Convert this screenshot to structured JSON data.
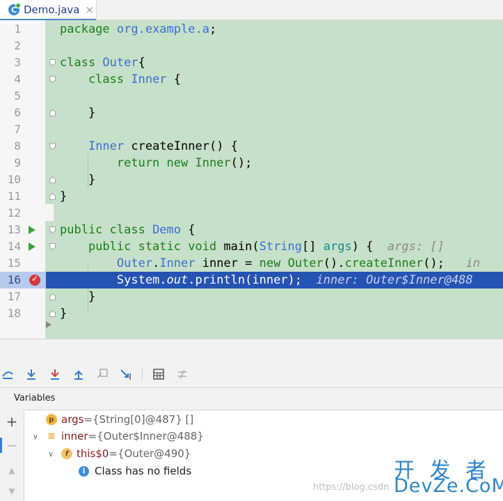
{
  "tab": {
    "icon_letter": "C",
    "file_name": "Demo.java",
    "close": "×"
  },
  "editor": {
    "lines": [
      {
        "n": "1",
        "segs": [
          {
            "t": "package ",
            "c": "kw"
          },
          {
            "t": "org.example.a",
            "c": "ty"
          },
          {
            "t": ";",
            "c": ""
          }
        ]
      },
      {
        "n": "2",
        "segs": []
      },
      {
        "n": "3",
        "segs": [
          {
            "t": "class ",
            "c": "kw"
          },
          {
            "t": "Outer",
            "c": "ty"
          },
          {
            "t": "{",
            "c": ""
          }
        ]
      },
      {
        "n": "4",
        "segs": [
          {
            "t": "    class ",
            "c": "kw"
          },
          {
            "t": "Inner",
            "c": "ty"
          },
          {
            "t": " {",
            "c": ""
          }
        ]
      },
      {
        "n": "5",
        "segs": []
      },
      {
        "n": "6",
        "segs": [
          {
            "t": "    }",
            "c": ""
          }
        ]
      },
      {
        "n": "7",
        "segs": []
      },
      {
        "n": "8",
        "segs": [
          {
            "t": "    ",
            "c": ""
          },
          {
            "t": "Inner",
            "c": "ty"
          },
          {
            "t": " createInner() {",
            "c": ""
          }
        ]
      },
      {
        "n": "9",
        "segs": [
          {
            "t": "        return new ",
            "c": "kw"
          },
          {
            "t": "Inner",
            "c": "kw"
          },
          {
            "t": "();",
            "c": ""
          }
        ]
      },
      {
        "n": "10",
        "segs": [
          {
            "t": "    }",
            "c": ""
          }
        ]
      },
      {
        "n": "11",
        "segs": [
          {
            "t": "}",
            "c": ""
          }
        ]
      },
      {
        "n": "12",
        "segs": []
      },
      {
        "n": "13",
        "segs": [
          {
            "t": "public class ",
            "c": "kw"
          },
          {
            "t": "Demo",
            "c": "ty"
          },
          {
            "t": " {",
            "c": ""
          }
        ]
      },
      {
        "n": "14",
        "segs": [
          {
            "t": "    public static void ",
            "c": "kw"
          },
          {
            "t": "main(",
            "c": ""
          },
          {
            "t": "String",
            "c": "ty"
          },
          {
            "t": "[] ",
            "c": ""
          },
          {
            "t": "args",
            "c": "teal"
          },
          {
            "t": ") {",
            "c": ""
          },
          {
            "t": "  args: []",
            "c": "hint"
          }
        ]
      },
      {
        "n": "15",
        "segs": [
          {
            "t": "        ",
            "c": ""
          },
          {
            "t": "Outer",
            "c": "ty"
          },
          {
            "t": ".",
            "c": ""
          },
          {
            "t": "Inner",
            "c": "ty"
          },
          {
            "t": " inner = ",
            "c": ""
          },
          {
            "t": "new ",
            "c": "kw"
          },
          {
            "t": "Outer",
            "c": "kw"
          },
          {
            "t": "().",
            "c": ""
          },
          {
            "t": "createInner",
            "c": "kw"
          },
          {
            "t": "();",
            "c": ""
          },
          {
            "t": "   in",
            "c": "hint"
          }
        ]
      },
      {
        "n": "16",
        "segs": [
          {
            "t": "        System.",
            "c": ""
          },
          {
            "t": "out",
            "c": "it"
          },
          {
            "t": ".println(inner);",
            "c": ""
          },
          {
            "t": "  inner: Outer$Inner@488",
            "c": "hint"
          }
        ]
      },
      {
        "n": "17",
        "segs": [
          {
            "t": "    }",
            "c": ""
          }
        ]
      },
      {
        "n": "18",
        "segs": [
          {
            "t": "}",
            "c": ""
          }
        ]
      }
    ]
  },
  "variables": {
    "title": "Variables",
    "items": [
      {
        "icon": "p",
        "name": "args",
        "eq": " = ",
        "value": "{String[0]@487} []",
        "toggle": ""
      },
      {
        "icon": "≡",
        "name": "inner",
        "eq": " = ",
        "value": "{Outer$Inner@488}",
        "toggle": "∨"
      },
      {
        "icon": "f",
        "name": "this$0",
        "eq": " = ",
        "value": "{Outer@490}",
        "toggle": "∨"
      }
    ],
    "info_text": "Class has no fields"
  },
  "watermark": {
    "url": "https://blog.csdn",
    "cn": "开 发 者",
    "en": "DevZe.CoM"
  },
  "colors": {
    "editor_bg": "#c7e0c9",
    "selection": "#2553b3",
    "keyword": "#1a7d1a",
    "type": "#3a6ed1"
  }
}
